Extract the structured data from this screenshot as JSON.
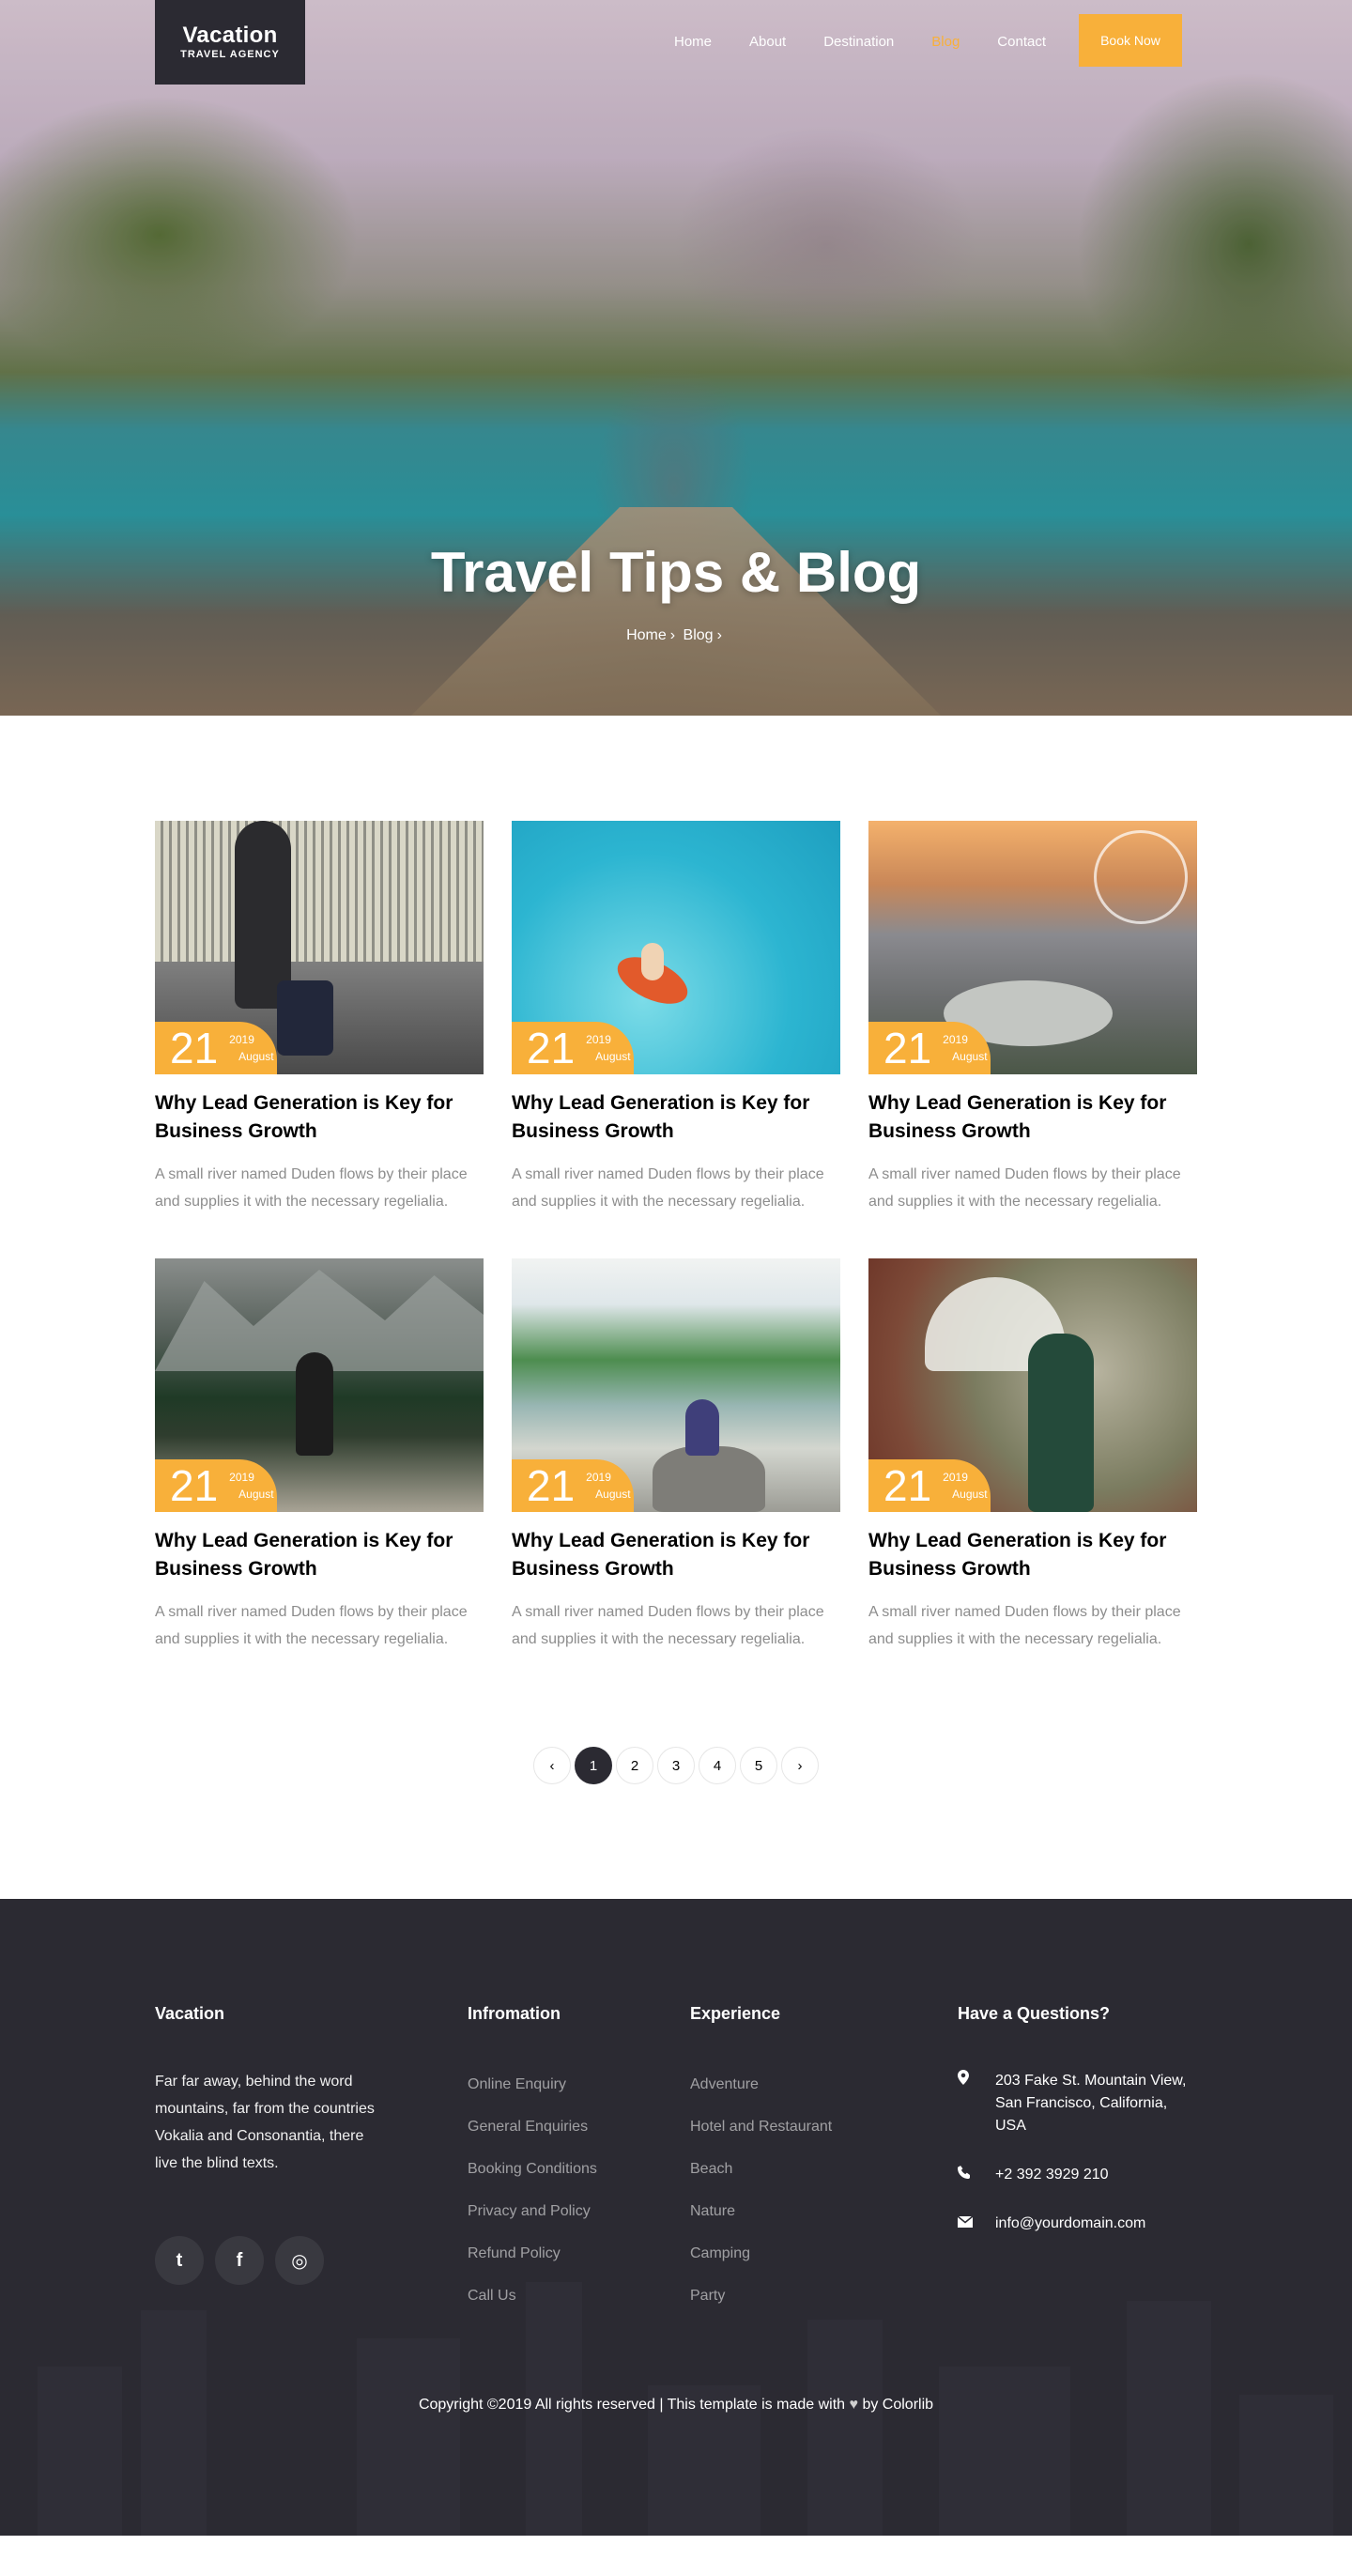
{
  "brand": {
    "title": "Vacation",
    "subtitle": "TRAVEL AGENCY"
  },
  "nav": {
    "items": [
      "Home",
      "About",
      "Destination",
      "Blog",
      "Contact"
    ],
    "active": "Blog",
    "cta": "Book Now"
  },
  "hero": {
    "title": "Travel Tips & Blog",
    "breadcrumb": [
      "Home",
      "Blog"
    ],
    "separator": "›"
  },
  "colors": {
    "accent": "#f8b03a",
    "dark": "#2b2a32",
    "muted": "#8d8d8d"
  },
  "posts": [
    {
      "day": "21",
      "year": "2019",
      "month": "August",
      "title": "Why Lead Generation is Key for Business Growth",
      "excerpt": "A small river named Duden flows by their place and supplies it with the necessary regelialia."
    },
    {
      "day": "21",
      "year": "2019",
      "month": "August",
      "title": "Why Lead Generation is Key for Business Growth",
      "excerpt": "A small river named Duden flows by their place and supplies it with the necessary regelialia."
    },
    {
      "day": "21",
      "year": "2019",
      "month": "August",
      "title": "Why Lead Generation is Key for Business Growth",
      "excerpt": "A small river named Duden flows by their place and supplies it with the necessary regelialia."
    },
    {
      "day": "21",
      "year": "2019",
      "month": "August",
      "title": "Why Lead Generation is Key for Business Growth",
      "excerpt": "A small river named Duden flows by their place and supplies it with the necessary regelialia."
    },
    {
      "day": "21",
      "year": "2019",
      "month": "August",
      "title": "Why Lead Generation is Key for Business Growth",
      "excerpt": "A small river named Duden flows by their place and supplies it with the necessary regelialia."
    },
    {
      "day": "21",
      "year": "2019",
      "month": "August",
      "title": "Why Lead Generation is Key for Business Growth",
      "excerpt": "A small river named Duden flows by their place and supplies it with the necessary regelialia."
    }
  ],
  "pagination": {
    "prev": "‹",
    "pages": [
      "1",
      "2",
      "3",
      "4",
      "5"
    ],
    "current": "1",
    "next": "›"
  },
  "footer": {
    "about": {
      "heading": "Vacation",
      "text": "Far far away, behind the word mountains, far from the countries Vokalia and Consonantia, there live the blind texts."
    },
    "socials": [
      {
        "icon": "twitter-icon",
        "glyph": "t"
      },
      {
        "icon": "facebook-icon",
        "glyph": "f"
      },
      {
        "icon": "instagram-icon",
        "glyph": "◎"
      }
    ],
    "information": {
      "heading": "Infromation",
      "links": [
        "Online Enquiry",
        "General Enquiries",
        "Booking Conditions",
        "Privacy and Policy",
        "Refund Policy",
        "Call Us"
      ]
    },
    "experience": {
      "heading": "Experience",
      "links": [
        "Adventure",
        "Hotel and Restaurant",
        "Beach",
        "Nature",
        "Camping",
        "Party"
      ]
    },
    "contact": {
      "heading": "Have a Questions?",
      "address": "203 Fake St. Mountain View, San Francisco, California, USA",
      "phone": "+2 392 3929 210",
      "email": "info@yourdomain.com"
    },
    "copyright_prefix": "Copyright ©2019 All rights reserved | This template is made with",
    "copyright_suffix": "by Colorlib"
  }
}
